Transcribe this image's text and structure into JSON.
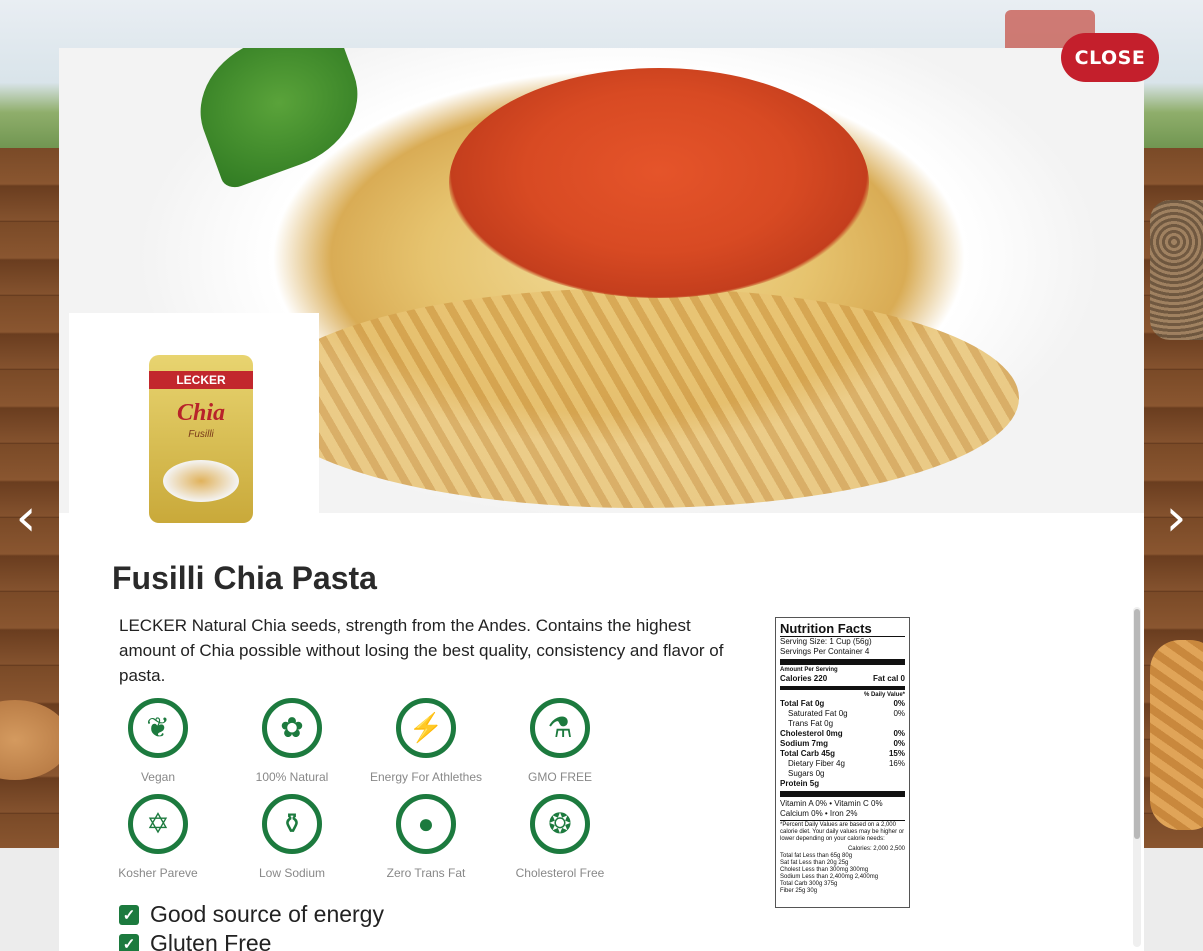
{
  "close_label": "CLOSE",
  "nav": {
    "prev_glyph": "‹",
    "next_glyph": "›"
  },
  "product": {
    "package": {
      "brand": "LECKER",
      "name": "Chia",
      "variant": "Fusilli"
    },
    "title": "Fusilli Chia Pasta",
    "description": "LECKER Natural Chia seeds, strength from the Andes. Contains the highest amount of Chia possible without losing the best quality, consistency and flavor of pasta."
  },
  "features": [
    {
      "label": "Vegan",
      "icon": "leaf-icon",
      "glyph": "❦"
    },
    {
      "label": "100% Natural",
      "icon": "flower-icon",
      "glyph": "✿"
    },
    {
      "label": "Energy For Athlethes",
      "icon": "runner-icon",
      "glyph": "⚡"
    },
    {
      "label": "GMO FREE",
      "icon": "test-tube-icon",
      "glyph": "⚗"
    },
    {
      "label": "Kosher Pareve",
      "icon": "star-of-david-icon",
      "glyph": "✡"
    },
    {
      "label": "Low Sodium",
      "icon": "salt-shaker-icon",
      "glyph": "⚱"
    },
    {
      "label": "Zero Trans Fat",
      "icon": "drop-icon",
      "glyph": "●"
    },
    {
      "label": "Cholesterol Free",
      "icon": "berries-icon",
      "glyph": "❂"
    }
  ],
  "checks": [
    {
      "text": "Good source of energy",
      "icon": "checkbox-icon",
      "glyph": "✓"
    },
    {
      "text": "Gluten Free",
      "icon": "checkbox-icon",
      "glyph": "✓"
    }
  ],
  "nutrition": {
    "title": "Nutrition Facts",
    "serving_size": "Serving Size: 1 Cup (56g)",
    "servings_per_container": "Servings Per Container 4",
    "amount_per_serving": "Amount Per Serving",
    "calories_label": "Calories 220",
    "fat_cal": "Fat cal 0",
    "dv_header": "% Daily Value*",
    "rows": [
      {
        "label": "Total Fat 0g",
        "value": "0%",
        "bold": true
      },
      {
        "label": "Saturated Fat 0g",
        "value": "0%",
        "bold": false
      },
      {
        "label": "Trans Fat 0g",
        "value": "",
        "bold": false
      },
      {
        "label": "Cholesterol 0mg",
        "value": "0%",
        "bold": true
      },
      {
        "label": "Sodium 7mg",
        "value": "0%",
        "bold": true
      },
      {
        "label": "Total Carb 45g",
        "value": "15%",
        "bold": true
      },
      {
        "label": "Dietary Fiber 4g",
        "value": "16%",
        "bold": false
      },
      {
        "label": "Sugars 0g",
        "value": "",
        "bold": false
      },
      {
        "label": "Protein 5g",
        "value": "",
        "bold": true
      }
    ],
    "vitamins_1": "Vitamin A 0% • Vitamin C 0%",
    "vitamins_2": "Calcium 0% • Iron 2%",
    "footnote": "*Percent Daily Values are based on a 2,000 calorie diet. Your daily values may be higher or lower depending on your calorie needs:",
    "table_header": "Calories: 2,000 2,500",
    "table": [
      "Total fat  Less than  65g  80g",
      "Sat fat  Less than  20g  25g",
      "Cholest  Less than  300mg  300mg",
      "Sodium  Less than  2,400mg  2,400mg",
      "Total Carb  300g  375g",
      "Fiber  25g  30g"
    ]
  },
  "colors": {
    "accent_green": "#1c7a3e",
    "close_red": "#c41f2c"
  }
}
